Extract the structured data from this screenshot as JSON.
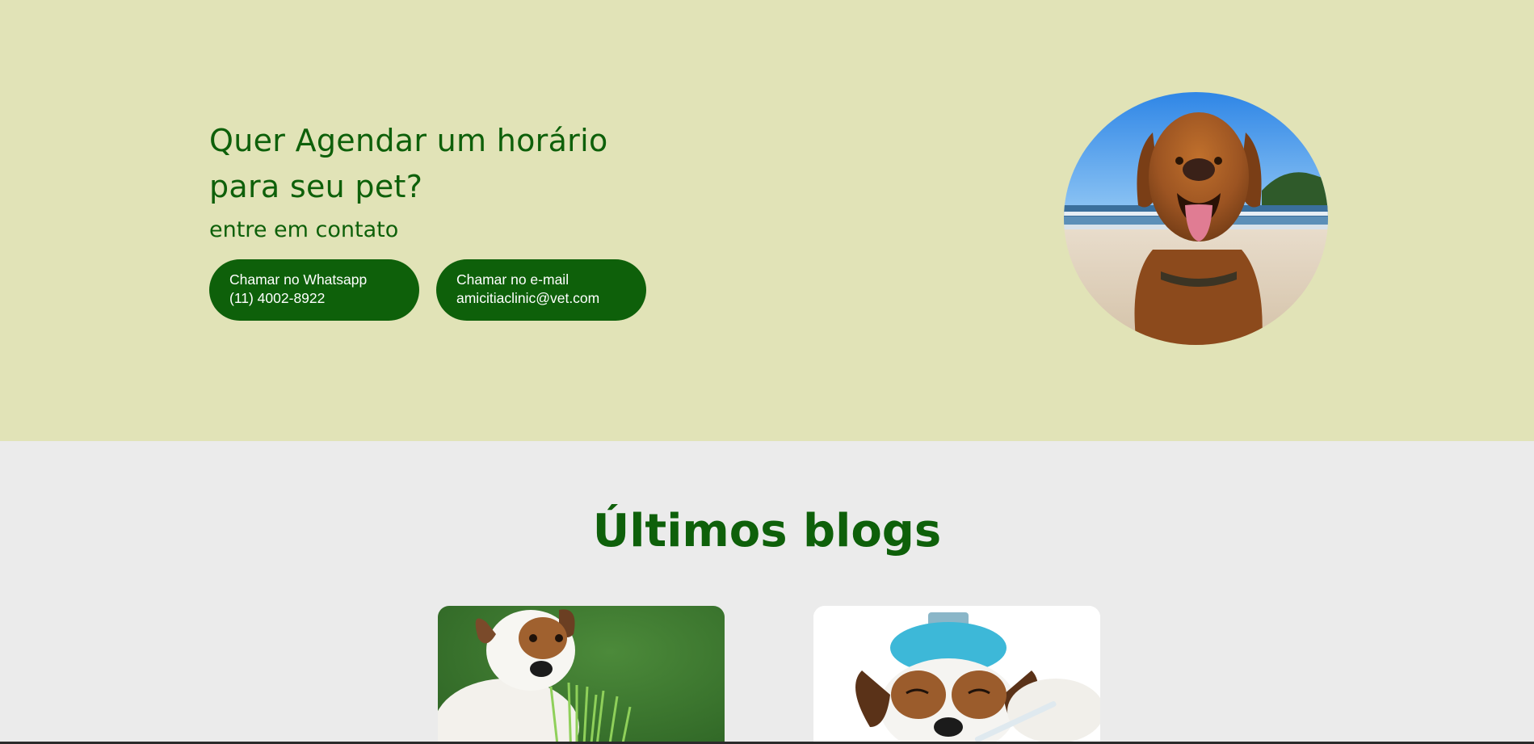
{
  "contact": {
    "title_line1": "Quer Agendar um horário",
    "title_line2": "para seu pet?",
    "subtitle": "entre em contato",
    "whatsapp_button": {
      "label": "Chamar no Whatsapp",
      "value": "(11) 4002-8922"
    },
    "email_button": {
      "label": "Chamar no e-mail",
      "value": "amicitiaclinic@vet.com"
    }
  },
  "blogs": {
    "heading": "Últimos blogs"
  },
  "colors": {
    "brand_green": "#0e600a",
    "hero_background": "#e1e3b7",
    "page_background": "#ebebeb"
  },
  "icons": {
    "hero_photo": "golden-retriever-beach-photo",
    "blog_1": "dog-eating-grass-photo",
    "blog_2": "sick-dog-ice-pack-photo"
  }
}
